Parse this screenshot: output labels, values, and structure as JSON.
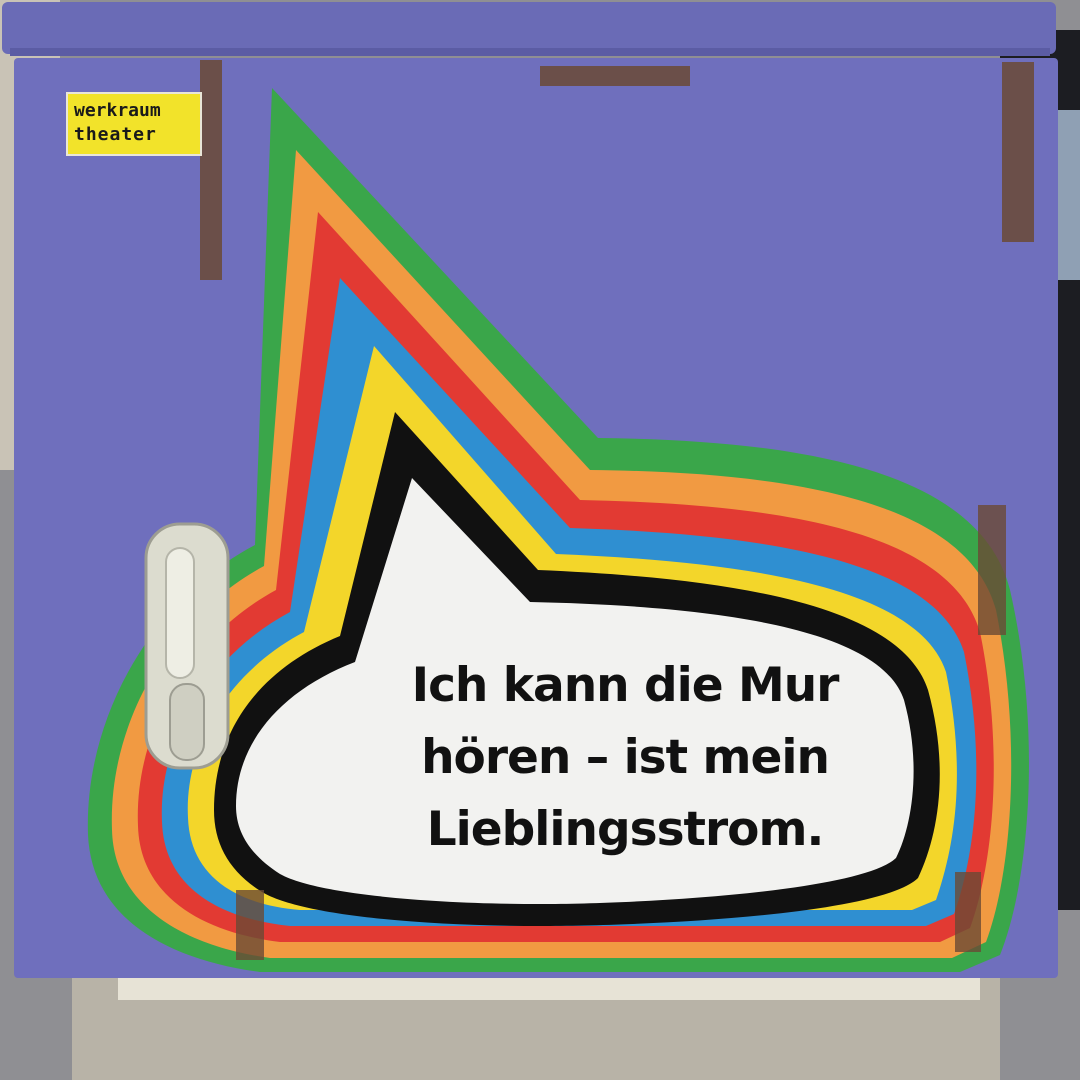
{
  "sticker": {
    "line1": "werkraum",
    "line2": "theater"
  },
  "speech_bubble": {
    "lines": [
      "Ich kann die Mur",
      "hören – ist mein",
      "Lieblingsstrom."
    ]
  },
  "colors": {
    "box_purple": "#6f6fbd",
    "stripe_green": "#3aa64a",
    "stripe_orange": "#f19a42",
    "stripe_red": "#e23a33",
    "stripe_blue": "#2f8fd1",
    "stripe_yellow": "#f3d62a",
    "outline_black": "#111111",
    "bubble_white": "#f2f2f0"
  }
}
